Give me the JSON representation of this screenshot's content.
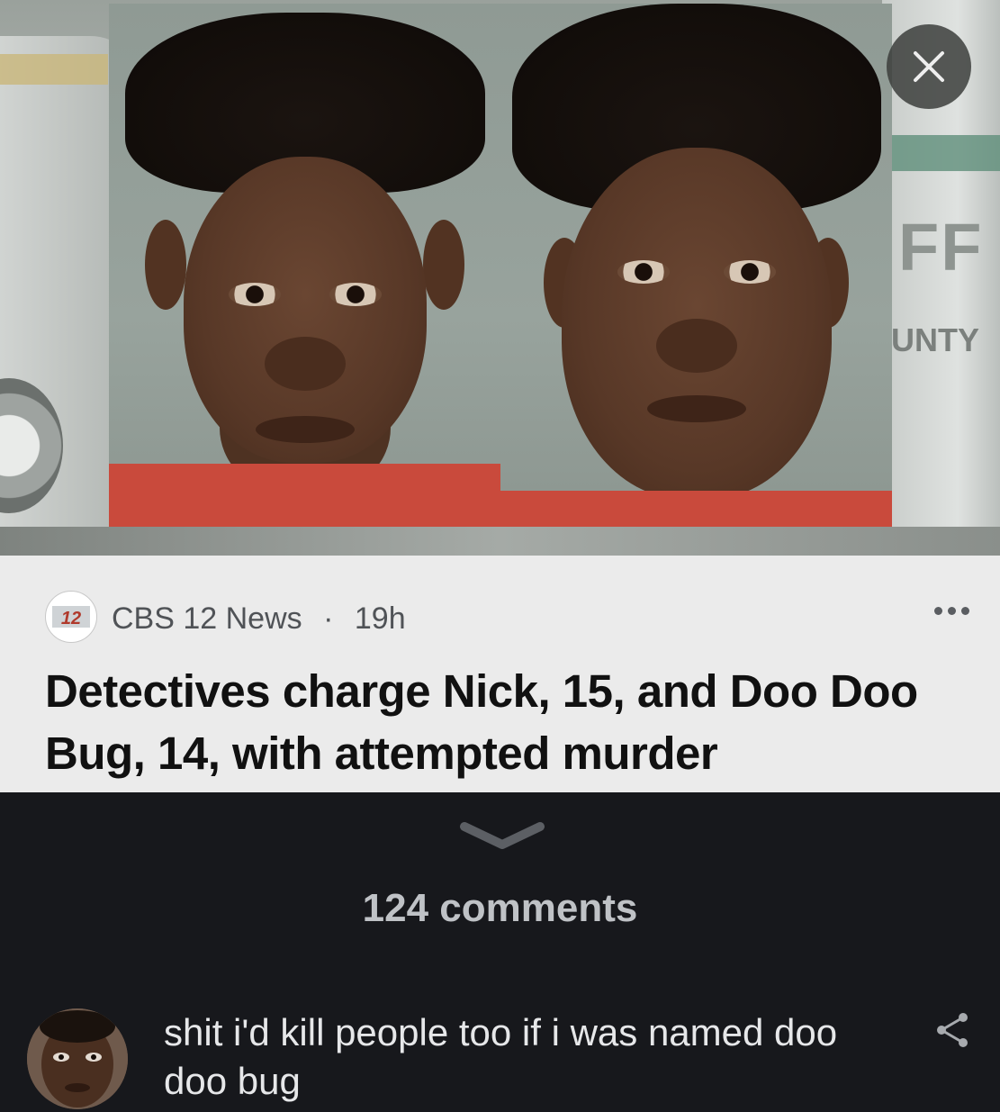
{
  "post": {
    "source_name": "CBS 12 News",
    "separator": "·",
    "age": "19h",
    "logo_text": "12",
    "headline": "Detectives charge Nick, 15, and Doo Doo Bug, 14, with attempted murder"
  },
  "photo_background": {
    "vehicle_text_top": "FF",
    "vehicle_text_bottom": "UNTY"
  },
  "comments": {
    "count_label": "124 comments",
    "items": [
      {
        "text": "shit i'd kill people too if i was named doo doo bug"
      }
    ]
  },
  "icons": {
    "close": "close-icon",
    "more": "more-options-icon",
    "expand": "chevron-down-icon",
    "share": "share-icon"
  },
  "colors": {
    "card_background": "#ebebeb",
    "dark_background": "#17181c",
    "headline": "#111111",
    "meta_text": "#505357",
    "shirt_red": "#c94a3c"
  }
}
